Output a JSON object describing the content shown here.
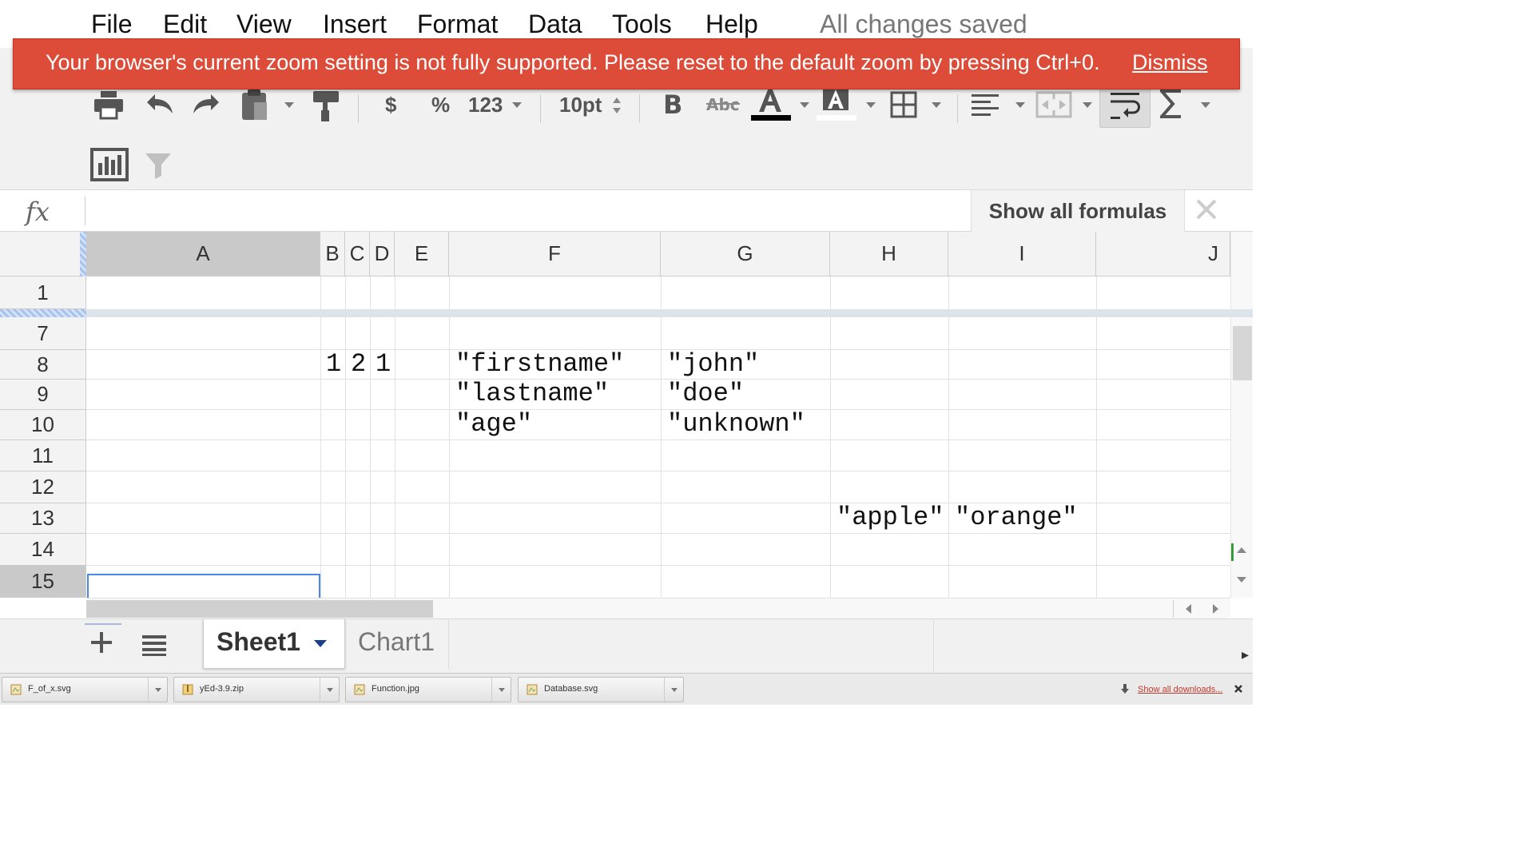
{
  "menu": {
    "items": [
      "File",
      "Edit",
      "View",
      "Insert",
      "Format",
      "Data",
      "Tools",
      "Help"
    ],
    "status": "All changes saved"
  },
  "banner": {
    "message": "Your browser's current zoom setting is not fully supported. Please reset to the default zoom by pressing Ctrl+0.",
    "dismiss_label": "Dismiss",
    "color": "#dd4b39"
  },
  "toolbar": {
    "currency_label": "$",
    "percent_label": "%",
    "number_format_label": "123",
    "font_size": "10pt",
    "text_color": "#000000",
    "highlight_color": "#ffffff",
    "icons": [
      "print-icon",
      "undo-icon",
      "redo-icon",
      "paste-icon",
      "paint-format-icon",
      "bold-icon",
      "strikethrough-icon",
      "text-color-icon",
      "highlight-color-icon",
      "borders-icon",
      "align-left-icon",
      "merge-cells-icon",
      "wrap-text-icon",
      "functions-icon",
      "insert-chart-icon",
      "filter-icon"
    ]
  },
  "formula_bar": {
    "fx_label": "fx",
    "value": "",
    "show_formulas_label": "Show all formulas"
  },
  "grid": {
    "columns": [
      "A",
      "B",
      "C",
      "D",
      "E",
      "F",
      "G",
      "H",
      "I",
      "J"
    ],
    "rows": [
      "1",
      "7",
      "8",
      "9",
      "10",
      "11",
      "12",
      "13",
      "14",
      "15"
    ],
    "selected_column": "A",
    "selected_row": "15",
    "selected_cell": "A15",
    "cells": {
      "B8": "1",
      "C8": "2",
      "D8": "1",
      "F8": "\"firstname\"",
      "G8": "\"john\"",
      "F9": "\"lastname\"",
      "G9": "\"doe\"",
      "F10": "\"age\"",
      "G10": "\"unknown\"",
      "H13": "\"apple\"",
      "I13": "\"orange\""
    }
  },
  "sheets": {
    "tabs": [
      "Sheet1",
      "Chart1"
    ],
    "active": "Sheet1"
  },
  "downloads": {
    "items": [
      "F_of_x.svg",
      "yEd-3.9.zip",
      "Function.jpg",
      "Database.svg"
    ],
    "show_all_label": "Show all downloads..."
  }
}
